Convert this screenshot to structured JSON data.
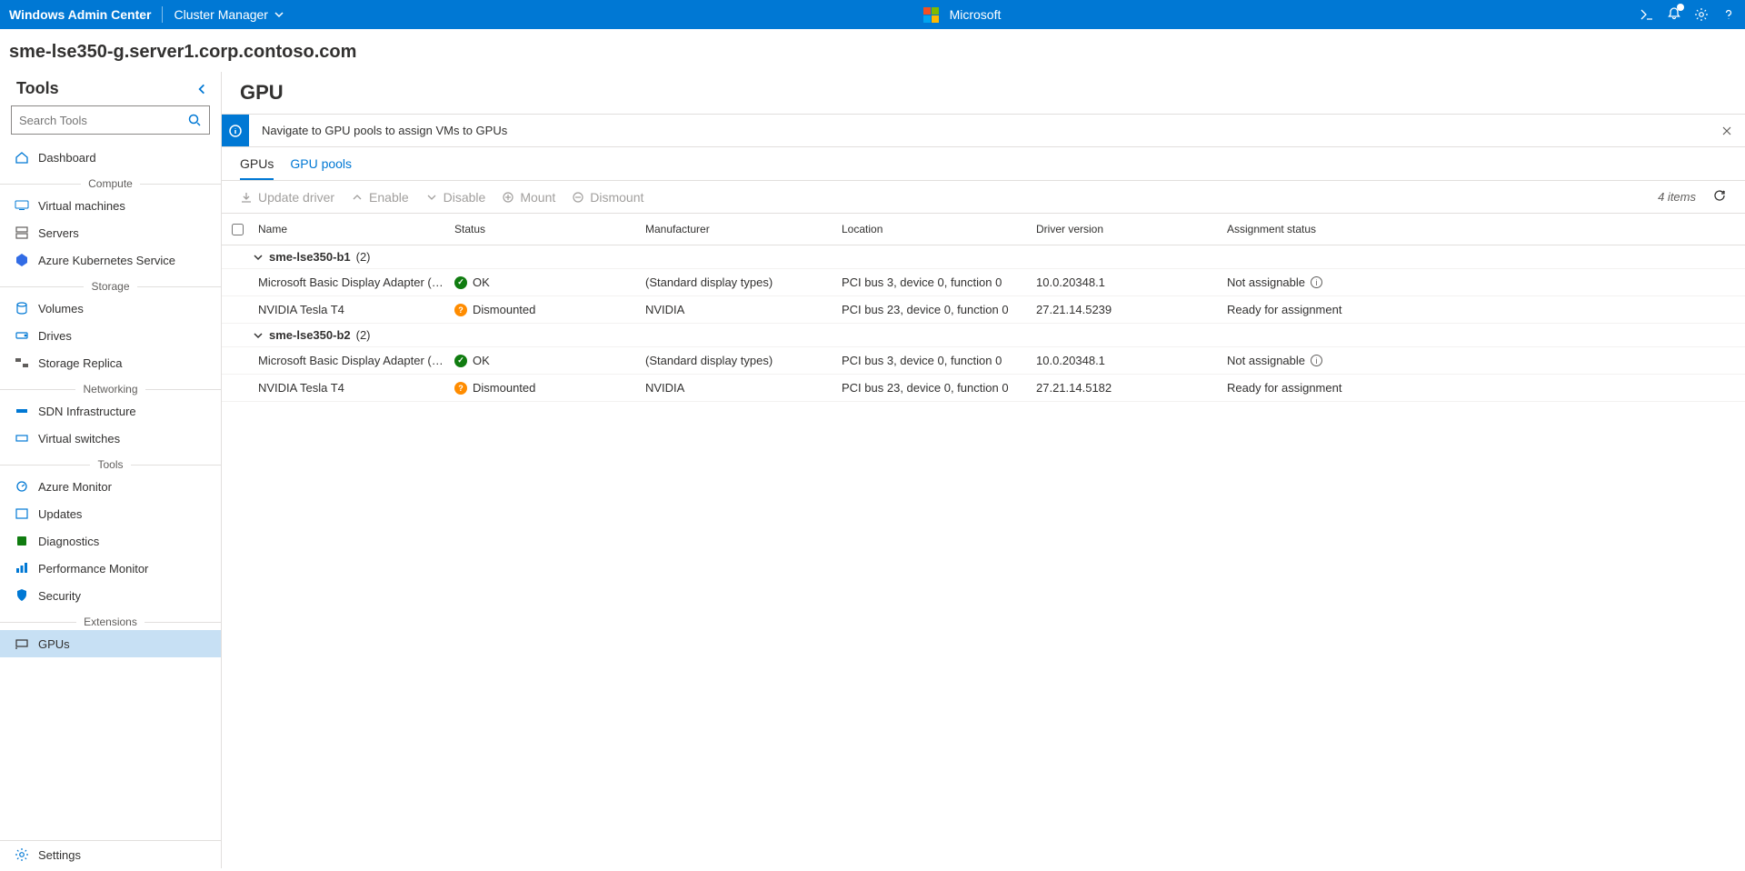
{
  "topbar": {
    "product": "Windows Admin Center",
    "context": "Cluster Manager",
    "brand": "Microsoft"
  },
  "server_name": "sme-lse350-g.server1.corp.contoso.com",
  "sidebar": {
    "title": "Tools",
    "search_placeholder": "Search Tools",
    "groups": {
      "compute": "Compute",
      "storage": "Storage",
      "networking": "Networking",
      "tools": "Tools",
      "extensions": "Extensions"
    },
    "items": {
      "dashboard": "Dashboard",
      "vms": "Virtual machines",
      "servers": "Servers",
      "aks": "Azure Kubernetes Service",
      "volumes": "Volumes",
      "drives": "Drives",
      "storage_replica": "Storage Replica",
      "sdn": "SDN Infrastructure",
      "vswitches": "Virtual switches",
      "azmonitor": "Azure Monitor",
      "updates": "Updates",
      "diagnostics": "Diagnostics",
      "perfmon": "Performance Monitor",
      "security": "Security",
      "gpus": "GPUs",
      "settings": "Settings"
    }
  },
  "page": {
    "title": "GPU",
    "banner": "Navigate to GPU pools to assign VMs to GPUs",
    "tabs": {
      "gpus": "GPUs",
      "pools": "GPU pools"
    },
    "toolbar": {
      "update": "Update driver",
      "enable": "Enable",
      "disable": "Disable",
      "mount": "Mount",
      "dismount": "Dismount",
      "count": "4 items"
    },
    "columns": {
      "name": "Name",
      "status": "Status",
      "manufacturer": "Manufacturer",
      "location": "Location",
      "driver": "Driver version",
      "assignment": "Assignment status"
    },
    "groups": [
      {
        "name": "sme-lse350-b1",
        "count": "(2)",
        "rows": [
          {
            "name": "Microsoft Basic Display Adapter (Low Resolu...",
            "status_kind": "ok",
            "status": "OK",
            "manufacturer": "(Standard display types)",
            "location": "PCI bus 3, device 0, function 0",
            "driver": "10.0.20348.1",
            "assignment": "Not assignable",
            "assign_info": true
          },
          {
            "name": "NVIDIA Tesla T4",
            "status_kind": "warn",
            "status": "Dismounted",
            "manufacturer": "NVIDIA",
            "location": "PCI bus 23, device 0, function 0",
            "driver": "27.21.14.5239",
            "assignment": "Ready for assignment",
            "assign_info": false
          }
        ]
      },
      {
        "name": "sme-lse350-b2",
        "count": "(2)",
        "rows": [
          {
            "name": "Microsoft Basic Display Adapter (Low Resolu...",
            "status_kind": "ok",
            "status": "OK",
            "manufacturer": "(Standard display types)",
            "location": "PCI bus 3, device 0, function 0",
            "driver": "10.0.20348.1",
            "assignment": "Not assignable",
            "assign_info": true
          },
          {
            "name": "NVIDIA Tesla T4",
            "status_kind": "warn",
            "status": "Dismounted",
            "manufacturer": "NVIDIA",
            "location": "PCI bus 23, device 0, function 0",
            "driver": "27.21.14.5182",
            "assignment": "Ready for assignment",
            "assign_info": false
          }
        ]
      }
    ]
  }
}
